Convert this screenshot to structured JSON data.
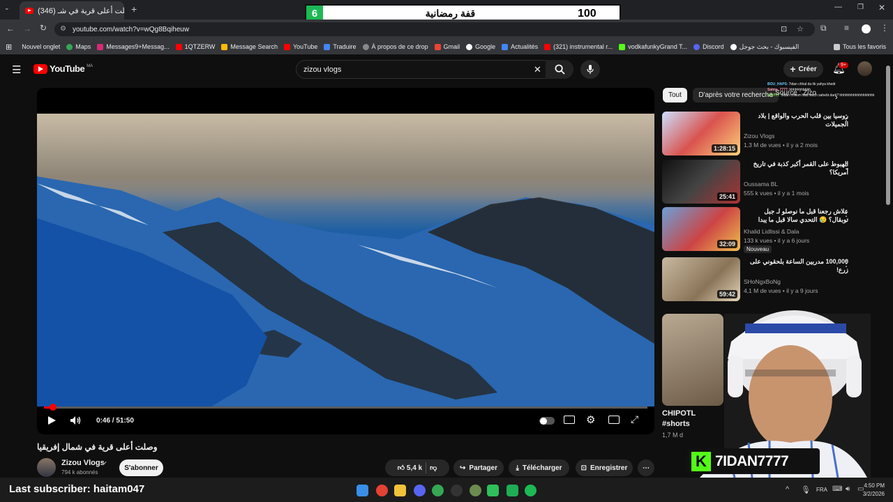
{
  "score_overlay": {
    "number": "6",
    "title": "قفة رمضانية",
    "value": "100"
  },
  "browser": {
    "tab_title": "(346) وصلت أعلى قرية في شـ",
    "url": "youtube.com/watch?v=wQg8Bqiheuw",
    "bookmarks": [
      "Nouvel onglet",
      "Maps",
      "Messages9+Messag...",
      "1QTZERW",
      "Message Search",
      "YouTube",
      "Traduire",
      "À propos de ce drop",
      "Gmail",
      "Google",
      "Actualités",
      "(321) instrumental r...",
      "vodkafunkyGrand T...",
      "Discord",
      "الفيسبوك - بحث جوجل"
    ],
    "all_bookmarks": "Tous les favoris"
  },
  "youtube": {
    "logo": "YouTube",
    "logo_region": "MA",
    "search_value": "zizou vlogs",
    "create_label": "Créer",
    "notif_count": "9+",
    "chips": [
      "Tout",
      "D'après votre recherche"
    ],
    "source_label": "Source : Zizo",
    "chat": [
      {
        "user": "BOU_HAPS",
        "text": ": 7idan chhal da lik yahya khedr"
      },
      {
        "user": "Salma_7777",
        "text": ": bhhhhhhhhhh"
      },
      {
        "user": "Lily777",
        "text": ": 9idan chikon hadi wach sahebt dark? hhhhhhhhhhhhhhhhhh"
      }
    ],
    "player": {
      "time": "0:46 / 51:50",
      "progress": 0.015
    },
    "video_title": "وصلت أعلى قرية في شمال إفريقيا",
    "channel": {
      "name": "Zizou Vlogs",
      "subs": "794 k abonnés",
      "subscribe": "S'abonner"
    },
    "actions": {
      "likes": "5,4 k",
      "share": "Partager",
      "download": "Télécharger",
      "save": "Enregistrer"
    },
    "recommendations": [
      {
        "title": "روسيا بين قلب الحرب والواقع | بلاد الجميلات",
        "channel": "Zizou Vlogs",
        "meta": "1,3 M de vues • il y a 2 mois",
        "duration": "1:28:15"
      },
      {
        "title": "الهبوط على القمر أكبر كذبة في تاريخ أمريكا؟",
        "channel": "Oussama BL",
        "meta": "555 k vues • il y a 1 mois",
        "duration": "25:41"
      },
      {
        "title": "علاش رجعنا قبل ما نوصلو لـ جبل توبقال؟ 😥 التحدي سالا قبل ما يبدا",
        "channel": "Khalid Lidlissi & Dala",
        "meta": "133 k vues • il y a 6 jours",
        "duration": "32:09",
        "badge": "Nouveau"
      },
      {
        "title": "100,000 مدربين الساعة بلحقوني على زرع!",
        "channel": "SHoNgxBoNg",
        "meta": "4,1 M de vues • il y a 9 jours",
        "duration": "59:42"
      }
    ],
    "shorts": {
      "title": "CHIPOTL",
      "tag": "#shorts",
      "views": "1,7 M d"
    }
  },
  "stream": {
    "last_subscriber": "Last subscriber: haitam047",
    "name": "7IDAN7777"
  },
  "system": {
    "lang": "FRA",
    "time": "4:50 PM",
    "date": "3/2/2026"
  }
}
